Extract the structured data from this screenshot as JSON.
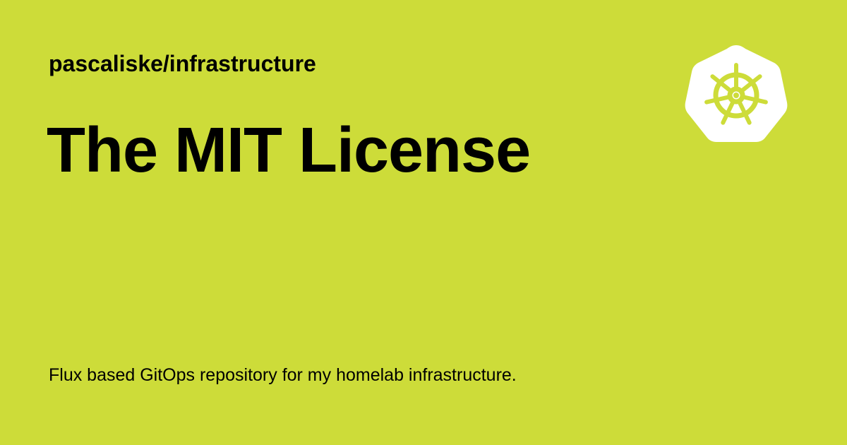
{
  "card": {
    "repository": "pascaliske/infrastructure",
    "title": "The MIT License",
    "description": "Flux based GitOps repository for my homelab infrastructure."
  },
  "logo": {
    "icon": "kubernetes-helm-icon"
  },
  "colors": {
    "background": "#cddc39",
    "text": "#000000",
    "logo_fill": "#ffffff"
  }
}
